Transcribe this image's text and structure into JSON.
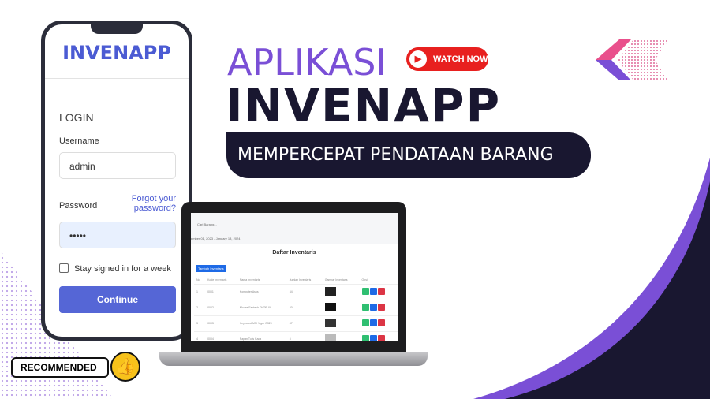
{
  "phone": {
    "brand": "INVENAPP",
    "login_title": "LOGIN",
    "username_label": "Username",
    "username_value": "admin",
    "password_label": "Password",
    "password_value": "•••••",
    "forgot_link": "Forgot your password?",
    "remember_label": "Stay signed in for a week",
    "continue_button": "Continue"
  },
  "headline": {
    "line1": "APLIKASI",
    "line2": "INVENAPP",
    "tagline": "MEMPERCEPAT PENDATAAN BARANG",
    "watch_now": "WATCH NOW"
  },
  "badge": {
    "recommended": "RECOMMENDED"
  },
  "laptop": {
    "search_placeholder": "Cari Barang...",
    "date_range": "ember 01, 2023 - January 18, 2024",
    "page_title": "Daftar Inventaris",
    "add_button": "Tambah Inventaris",
    "columns": [
      "No",
      "Kode Inventaris",
      "Nama Inventaris",
      "Jumlah Inventaris",
      "Gambar Inventaris",
      "Opsi"
    ],
    "rows": [
      [
        "1",
        "0001",
        "Komputer Asus",
        "34"
      ],
      [
        "2",
        "0002",
        "Mouse Fantech THOR X9",
        "20"
      ],
      [
        "3",
        "0003",
        "Keyboard MSI Vigor G320",
        "47"
      ],
      [
        "4",
        "0004",
        "Papan Tulis Kaca",
        "5"
      ]
    ]
  },
  "colors": {
    "purple": "#7a4fd6",
    "navy": "#191730",
    "red": "#e8201f",
    "pink": "#e9508c",
    "blue": "#5566d6"
  }
}
